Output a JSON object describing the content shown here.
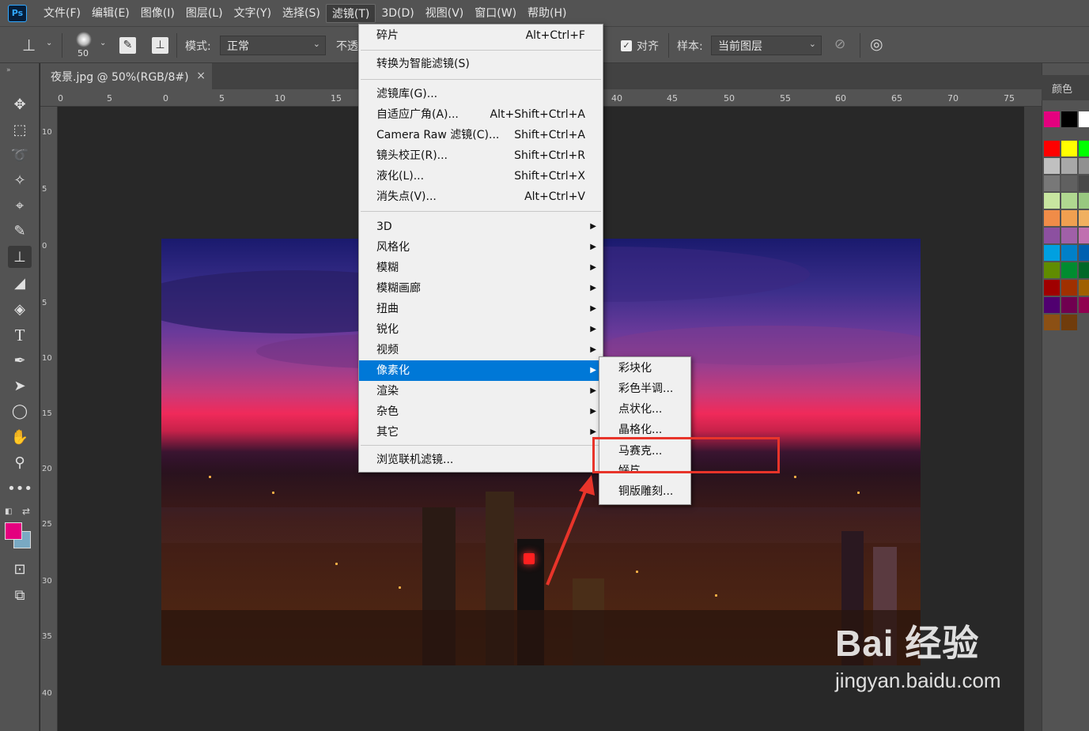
{
  "menubar": {
    "logo": "Ps",
    "items": [
      "文件(F)",
      "编辑(E)",
      "图像(I)",
      "图层(L)",
      "文字(Y)",
      "选择(S)",
      "滤镜(T)",
      "3D(D)",
      "视图(V)",
      "窗口(W)",
      "帮助(H)"
    ],
    "active_index": 6
  },
  "options": {
    "brush_size": "50",
    "mode_label": "模式:",
    "mode_value": "正常",
    "opacity_label": "不透",
    "align_label": "对齐",
    "sample_label": "样本:",
    "sample_value": "当前图层"
  },
  "document": {
    "tab_title": "夜景.jpg @ 50%(RGB/8#)",
    "close": "×",
    "ruler_top": [
      "0",
      "5",
      "0",
      "5",
      "10",
      "15",
      "40",
      "45",
      "50",
      "55",
      "60",
      "65",
      "70",
      "75"
    ],
    "ruler_left": [
      "10",
      "5",
      "0",
      "5",
      "10",
      "15",
      "20",
      "25",
      "30",
      "35",
      "40"
    ]
  },
  "right_panel": {
    "tab_label": "颜色",
    "swatches": [
      "#e4007f",
      "#000000",
      "#ffffff",
      "#ff0000",
      "#ffff00",
      "#00ff00",
      "#c0c0c0",
      "#a8a8a8",
      "#909090",
      "#787878",
      "#606060",
      "#484848",
      "#c8e6a0",
      "#b0d890",
      "#98c880",
      "#f08c48",
      "#f0a050",
      "#f0b060",
      "#8c50a0",
      "#a060a8",
      "#c070b0",
      "#00a0e0",
      "#0080c8",
      "#0060b0",
      "#608c00",
      "#008c30",
      "#006828",
      "#a00000",
      "#a03000",
      "#a06000",
      "#500070",
      "#700050",
      "#900050",
      "#8c5014",
      "#703c0c"
    ]
  },
  "filter_menu": {
    "top_items": [
      {
        "label": "碎片",
        "shortcut": "Alt+Ctrl+F"
      },
      {
        "label": "转换为智能滤镜(S)",
        "shortcut": ""
      }
    ],
    "mid_items": [
      {
        "label": "滤镜库(G)...",
        "shortcut": ""
      },
      {
        "label": "自适应广角(A)...",
        "shortcut": "Alt+Shift+Ctrl+A"
      },
      {
        "label": "Camera Raw 滤镜(C)...",
        "shortcut": "Shift+Ctrl+A"
      },
      {
        "label": "镜头校正(R)...",
        "shortcut": "Shift+Ctrl+R"
      },
      {
        "label": "液化(L)...",
        "shortcut": "Shift+Ctrl+X"
      },
      {
        "label": "消失点(V)...",
        "shortcut": "Alt+Ctrl+V"
      }
    ],
    "sub_items": [
      "3D",
      "风格化",
      "模糊",
      "模糊画廊",
      "扭曲",
      "锐化",
      "视频",
      "像素化",
      "渲染",
      "杂色",
      "其它"
    ],
    "highlight_index": 7,
    "browse": "浏览联机滤镜..."
  },
  "pixelate_submenu": [
    "彩块化",
    "彩色半调...",
    "点状化...",
    "晶格化...",
    "马赛克...",
    "碎片",
    "铜版雕刻..."
  ],
  "watermark": {
    "main": "Bai 经验",
    "sub": "jingyan.baidu.com"
  }
}
